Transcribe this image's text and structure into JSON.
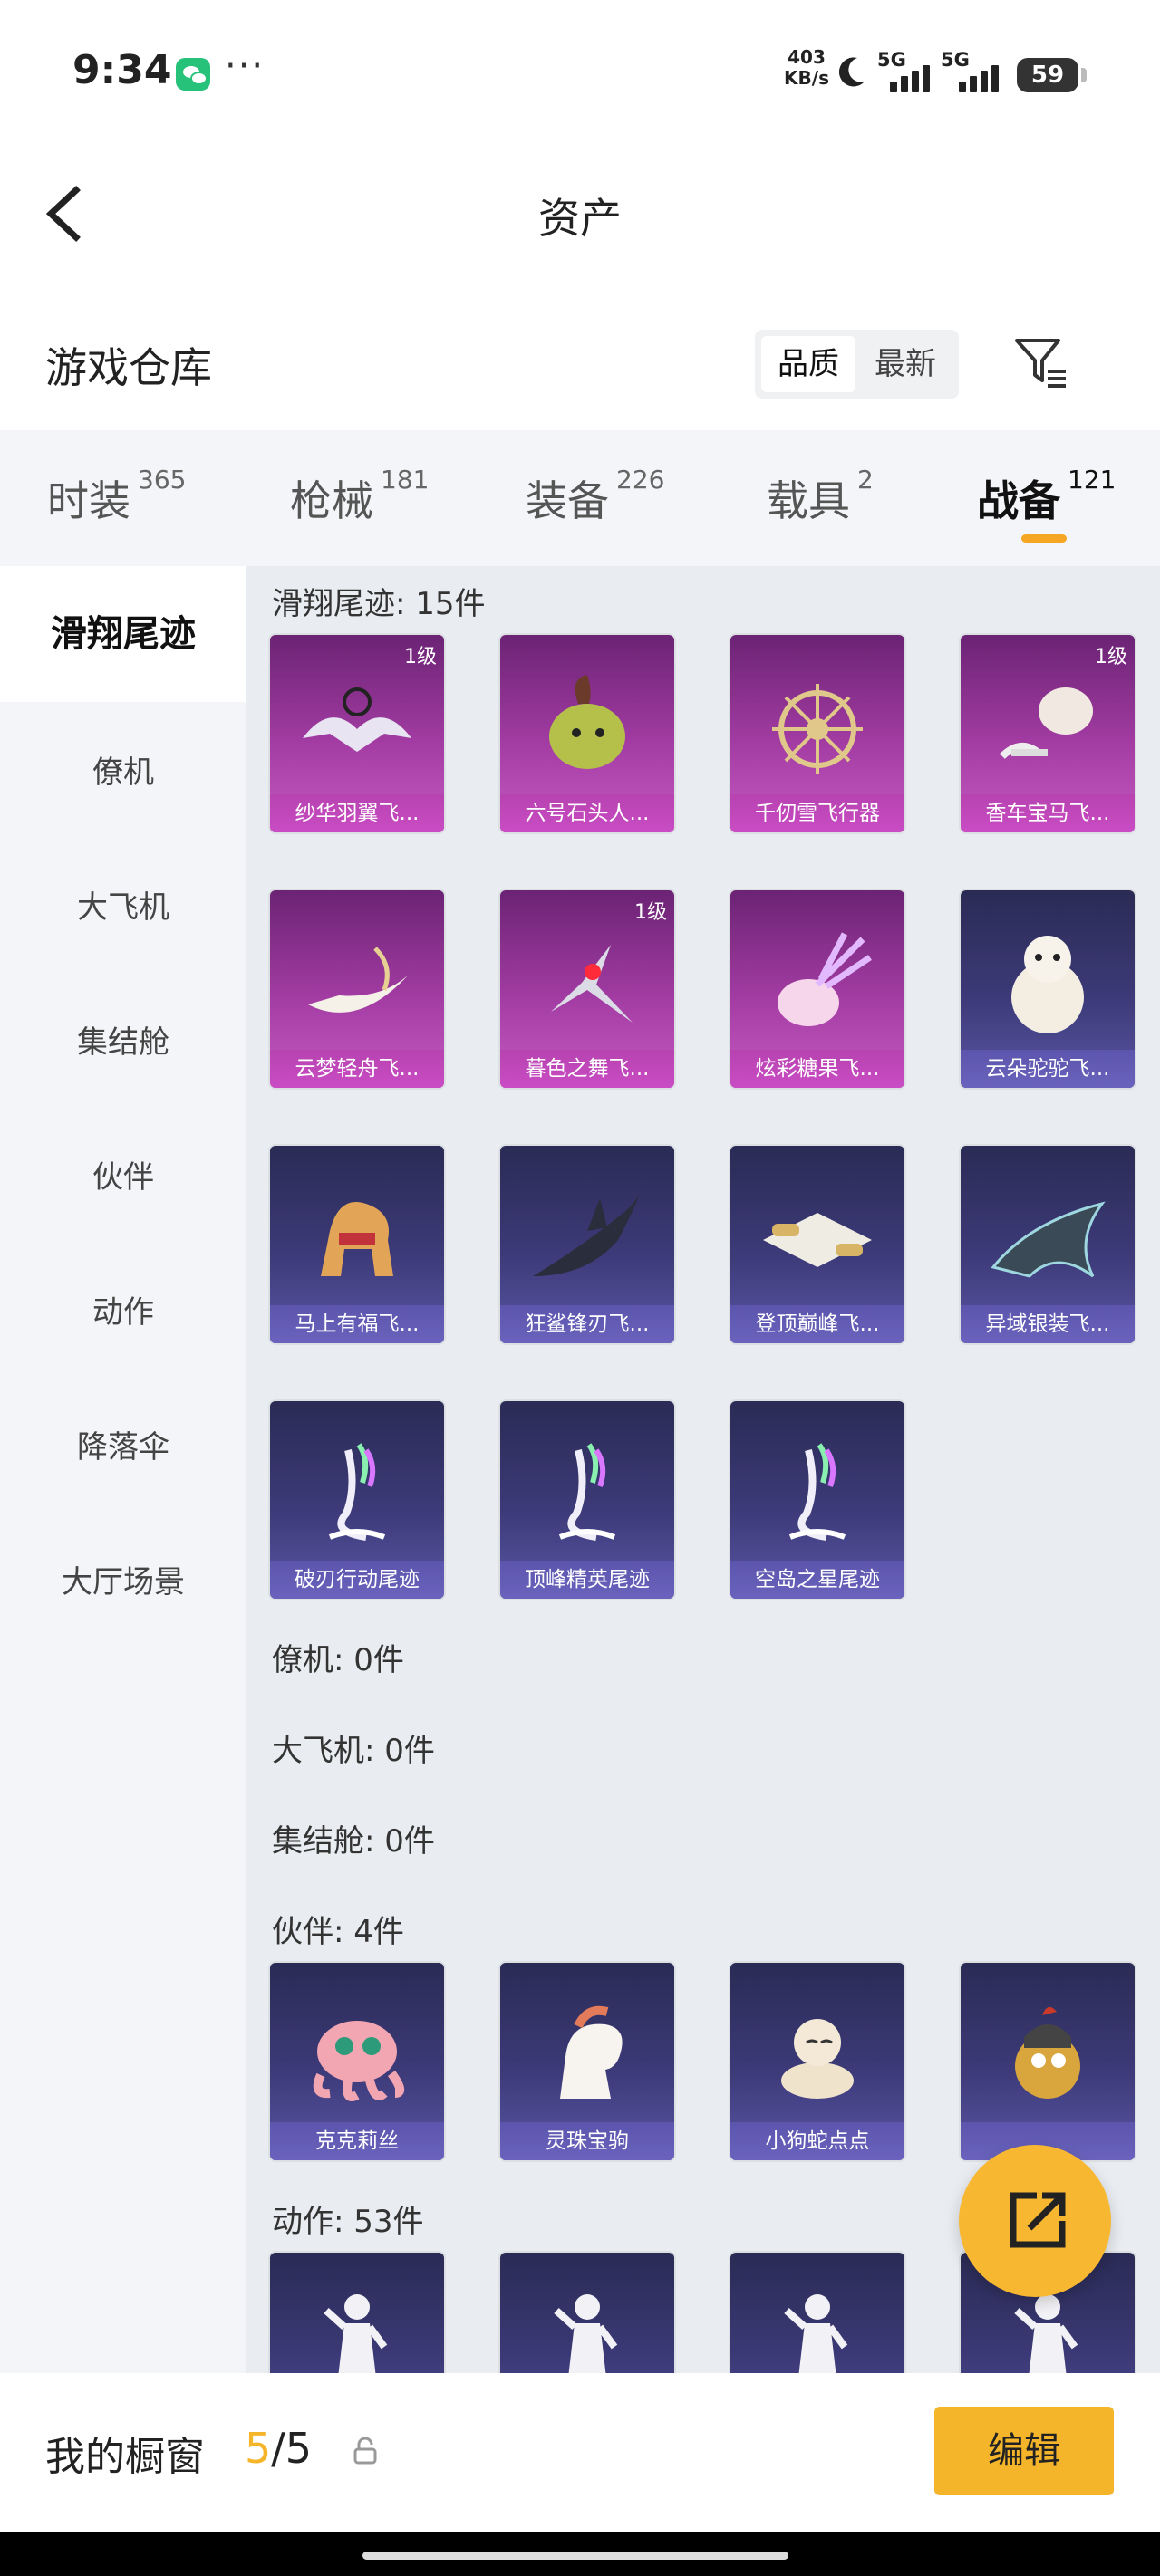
{
  "status_bar": {
    "time": "9:34",
    "more": "···",
    "net_speed_value": "403",
    "net_speed_unit": "KB/s",
    "sim1_label": "5G",
    "sim2_label": "5G",
    "battery": "59",
    "icons": [
      "wechat-icon",
      "moon-icon",
      "signal-icon",
      "battery-icon"
    ]
  },
  "nav": {
    "title": "资产",
    "back_icon": "chevron-left-icon"
  },
  "header": {
    "title": "游戏仓库",
    "sort_options": [
      "品质",
      "最新"
    ],
    "sort_selected": "品质",
    "filter_icon": "filter-icon"
  },
  "tabs": [
    {
      "label": "时装",
      "count": "365",
      "active": false
    },
    {
      "label": "枪械",
      "count": "181",
      "active": false
    },
    {
      "label": "装备",
      "count": "226",
      "active": false
    },
    {
      "label": "载具",
      "count": "2",
      "active": false
    },
    {
      "label": "战备",
      "count": "121",
      "active": true
    }
  ],
  "tab_accent_color": "#f5a623",
  "sidebar": {
    "items": [
      "滑翔尾迹",
      "僚机",
      "大飞机",
      "集结舱",
      "伙伴",
      "动作",
      "降落伞",
      "大厅场景"
    ],
    "active": "滑翔尾迹"
  },
  "content": {
    "sections": [
      {
        "label": "滑翔尾迹: 15件",
        "items": [
          {
            "name": "纱华羽翼飞...",
            "level": "1级",
            "rarity": "purple",
            "icon": "glider-icon"
          },
          {
            "name": "六号石头人...",
            "level": "",
            "rarity": "purple",
            "icon": "creature-icon"
          },
          {
            "name": "千仞雪飞行器",
            "level": "",
            "rarity": "purple",
            "icon": "wheel-icon"
          },
          {
            "name": "香车宝马飞...",
            "level": "1级",
            "rarity": "purple",
            "icon": "carriage-icon"
          },
          {
            "name": "云梦轻舟飞...",
            "level": "",
            "rarity": "purple",
            "icon": "boat-icon"
          },
          {
            "name": "暮色之舞飞...",
            "level": "1级",
            "rarity": "purple",
            "icon": "swallow-icon"
          },
          {
            "name": "炫彩糖果飞...",
            "level": "",
            "rarity": "purple",
            "icon": "candy-icon"
          },
          {
            "name": "云朵驼驼飞...",
            "level": "",
            "rarity": "blue",
            "icon": "alpaca-icon"
          },
          {
            "name": "马上有福飞...",
            "level": "",
            "rarity": "blue",
            "icon": "horse-icon"
          },
          {
            "name": "狂鲨锋刃飞...",
            "level": "",
            "rarity": "blue",
            "icon": "shark-icon"
          },
          {
            "name": "登顶巅峰飞...",
            "level": "",
            "rarity": "blue",
            "icon": "aircraft-icon"
          },
          {
            "name": "异域银装飞...",
            "level": "",
            "rarity": "blue",
            "icon": "dragon-icon"
          },
          {
            "name": "破刃行动尾迹",
            "level": "",
            "rarity": "blue",
            "icon": "trail-icon"
          },
          {
            "name": "顶峰精英尾迹",
            "level": "",
            "rarity": "blue",
            "icon": "trail-icon"
          },
          {
            "name": "空岛之星尾迹",
            "level": "",
            "rarity": "blue",
            "icon": "trail-icon"
          }
        ]
      },
      {
        "label": "僚机: 0件",
        "items": []
      },
      {
        "label": "大飞机: 0件",
        "items": []
      },
      {
        "label": "集结舱: 0件",
        "items": []
      },
      {
        "label": "伙伴: 4件",
        "items": [
          {
            "name": "克克莉丝",
            "level": "",
            "rarity": "blue",
            "icon": "octopus-icon"
          },
          {
            "name": "灵珠宝驹",
            "level": "",
            "rarity": "blue",
            "icon": "pony-icon"
          },
          {
            "name": "小狗蛇点点",
            "level": "",
            "rarity": "blue",
            "icon": "snake-icon"
          },
          {
            "name": "",
            "level": "",
            "rarity": "blue",
            "icon": "chicken-icon"
          }
        ]
      },
      {
        "label": "动作: 53件",
        "items": [
          {
            "name": "",
            "level": "",
            "rarity": "blue",
            "icon": "pose-icon"
          },
          {
            "name": "",
            "level": "",
            "rarity": "blue",
            "icon": "pose-icon"
          },
          {
            "name": "",
            "level": "",
            "rarity": "blue",
            "icon": "pose-icon"
          },
          {
            "name": "",
            "level": "",
            "rarity": "blue",
            "icon": "pose-icon"
          }
        ]
      }
    ]
  },
  "float_button_icon": "share-external-icon",
  "bottom_bar": {
    "label": "我的橱窗",
    "count_current": "5",
    "count_sep": "/",
    "count_total": "5",
    "lock_icon": "lock-icon",
    "edit_label": "编辑",
    "accent_color": "#f5b52a"
  }
}
